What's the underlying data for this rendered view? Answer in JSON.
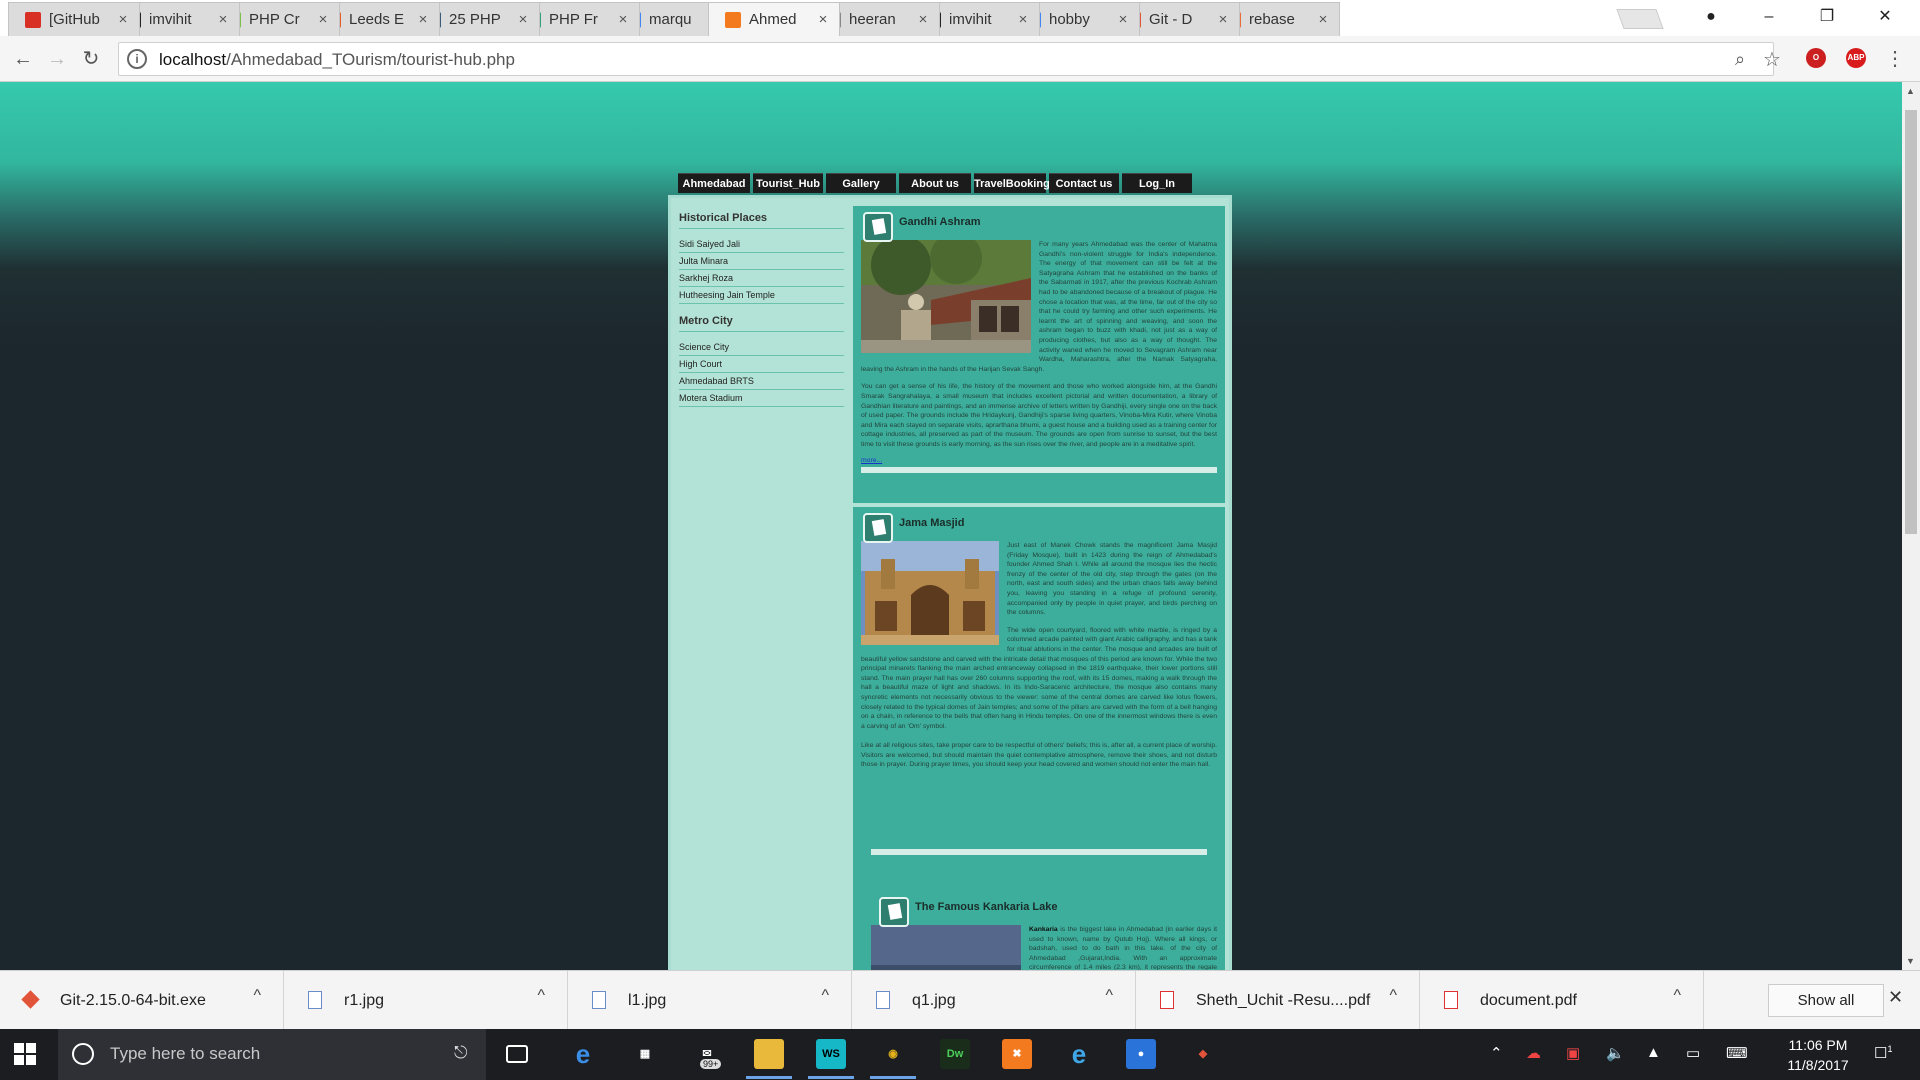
{
  "browser": {
    "tabs": [
      {
        "title": "[GitHub",
        "icon": "gmail-icon",
        "color": "#d93025"
      },
      {
        "title": "imvihit",
        "icon": "github-icon",
        "color": "#222222"
      },
      {
        "title": "PHP Cr",
        "icon": "php-site-icon",
        "color": "#7cc04b"
      },
      {
        "title": "Leeds E",
        "icon": "leeds-icon",
        "color": "#e65a2a"
      },
      {
        "title": "25 PHP",
        "icon": "laptop-icon",
        "color": "#3a5a78"
      },
      {
        "title": "PHP Fr",
        "icon": "php-framework-icon",
        "color": "#35a07a"
      },
      {
        "title": "marqu",
        "icon": "google-icon",
        "color": "#4285f4"
      },
      {
        "title": "Ahmed",
        "icon": "xampp-icon",
        "color": "#f47a20"
      },
      {
        "title": "heeran",
        "icon": "document-icon",
        "color": "#888888"
      },
      {
        "title": "imvihit",
        "icon": "github-icon",
        "color": "#222222"
      },
      {
        "title": "hobby",
        "icon": "google-icon",
        "color": "#4285f4"
      },
      {
        "title": "Git - D",
        "icon": "git-icon",
        "color": "#e2543a"
      },
      {
        "title": "rebase",
        "icon": "rebase-icon",
        "color": "#e86b3a"
      }
    ],
    "active_tab": 7,
    "url_host": "localhost",
    "url_path": "/Ahmedabad_TOurism/tourist-hub.php",
    "win_min": "–",
    "win_max": "❐",
    "win_close": "✕",
    "close_glyph": "×",
    "back_glyph": "←",
    "forward_glyph": "→",
    "reload_glyph": "↻",
    "zoom_glyph": "⌕",
    "star_glyph": "☆",
    "menu_glyph": "⋮",
    "abp_label": "ABP"
  },
  "site": {
    "menu": [
      "Ahmedabad",
      "Tourist_Hub",
      "Gallery",
      "About us",
      "TravelBooking",
      "Contact us",
      "Log_In"
    ],
    "sidebar": {
      "historical_heading": "Historical Places",
      "historical_items": [
        "Sidi Saiyed Jali",
        "Julta Minara",
        "Sarkhej Roza",
        "Hutheesing Jain Temple"
      ],
      "metro_heading": "Metro City",
      "metro_items": [
        "Science City",
        "High Court",
        "Ahmedabad BRTS",
        "Motera Stadium"
      ]
    },
    "posts": {
      "gandhi": {
        "title": "Gandhi Ashram",
        "p1": "For many years Ahmedabad was the center of Mahatma Gandhi's non-violent struggle for India's independence. The energy of that movement can still be felt at the Satyagraha Ashram that he established on the banks of the Sabarmati in 1917, after the previous Kochrab Ashram had to be abandoned because of a breakout of plague. He chose a location that was, at the time, far out of the city so that he could try farming and other such experiments. He learnt the art of spinning and weaving, and soon the ashram began to buzz with khadi, not just as a way of producing clothes, but also as a way of thought. The activity waned when he moved to Sevagram Ashram near Wardha, Maharashtra, after the Namak Satyagraha, leaving the Ashram in the hands of the Harijan Sevak Sangh.",
        "p2": "You can get a sense of his life, the history of the movement and those who worked alongside him, at the Gandhi Smarak Sangrahalaya, a small museum that includes excellent pictorial and written documentation, a library of Gandhian literature and paintings, and an immense archive of letters written by Gandhiji, every single one on the back of used paper. The grounds include the Hridaykunj, Gandhiji's sparse living quarters, Vinoba-Mira Kutir, where Vinoba and Mira each stayed on separate visits, aprarthana bhumi, a guest house and a building used as a training center for cottage industries, all preserved as part of the museum. The grounds are open from sunrise to sunset, but the best time to visit these grounds is early morning, as the sun rises over the river, and people are in a meditative spirit.",
        "more": "more..."
      },
      "jama": {
        "title": "Jama Masjid",
        "p1": "Just east of Manek Chowk stands the magnificent Jama Masjid (Friday Mosque), built in 1423 during the reign of Ahmedabad's founder Ahmed Shah I. While all around the mosque lies the hectic frenzy of the center of the old city, step through the gates (on the north, east and south sides) and the urban chaos falls away behind you, leaving you standing in a refuge of profound serenity, accompanied only by people in quiet prayer, and birds perching on the columns.",
        "p2": "The wide open courtyard, floored with white marble, is ringed by a columned arcade painted with giant Arabic calligraphy, and has a tank for ritual ablutions in the center. The mosque and arcades are built of beautiful yellow sandstone and carved with the intricate detail that mosques of this period are known for. While the two principal minarets flanking the main arched entranceway collapsed in the 1819 earthquake, their lower portions still stand. The main prayer hall has over 260 columns supporting the roof, with its 15 domes, making a walk through the hall a beautiful maze of light and shadows. In its Indo-Saracenic architecture, the mosque also contains many syncretic elements not necessarily obvious to the viewer: some of the central domes are carved like lotus flowers, closely related to the typical domes of Jain temples; and some of the pillars are carved with the form of a bell hanging on a chain, in reference to the bells that often hang in Hindu temples. On one of the innermost windows there is even a carving of an 'Om' symbol.",
        "p3": "Like at all religious sites, take proper care to be respectful of others' beliefs; this is, after all, a current place of worship. Visitors are welcomed, but should maintain the quiet contemplative atmosphere, remove their shoes, and not disturb those in prayer. During prayer times, you should keep your head covered and women should not enter the main hall."
      },
      "kankaria": {
        "title": "The Famous Kankaria Lake",
        "bold": "Kankaria",
        "p1": " is the biggest lake in Ahmedabad (in earlier days it used to known, name by Qutub Hoj). Where all kings, or badshah, used to do bath in this lake. of the city of Ahmedabad ,Gujarat,India. With an approximate circumference of 1.4 miles (2.3 km), it represents the regale history of"
      }
    }
  },
  "downloads": {
    "items": [
      {
        "name": "Git-2.15.0-64-bit.exe",
        "kind": "git"
      },
      {
        "name": "r1.jpg",
        "kind": "img"
      },
      {
        "name": "l1.jpg",
        "kind": "img"
      },
      {
        "name": "q1.jpg",
        "kind": "img"
      },
      {
        "name": "Sheth_Uchit -Resu....pdf",
        "kind": "pdf"
      },
      {
        "name": "document.pdf",
        "kind": "pdf"
      }
    ],
    "chevron": "^",
    "show_all": "Show all",
    "close": "✕"
  },
  "taskbar": {
    "search_placeholder": "Type here to search",
    "mail_badge": "99+",
    "apps": [
      {
        "name": "task-view-icon",
        "label": "",
        "bg": "transparent",
        "fg": "#ffffff",
        "running": false
      },
      {
        "name": "edge-icon",
        "label": "e",
        "bg": "transparent",
        "fg": "#3b8ee6",
        "running": false
      },
      {
        "name": "store-icon",
        "label": "▦",
        "bg": "transparent",
        "fg": "#ffffff",
        "running": false
      },
      {
        "name": "mail-icon",
        "label": "✉",
        "bg": "transparent",
        "fg": "#ffffff",
        "running": false
      },
      {
        "name": "file-explorer-icon",
        "label": "▬",
        "bg": "#e8b93a",
        "fg": "#e8b93a",
        "running": true
      },
      {
        "name": "webstorm-icon",
        "label": "WS",
        "bg": "#16b8c8",
        "fg": "#000000",
        "running": true
      },
      {
        "name": "chrome-icon",
        "label": "◉",
        "bg": "transparent",
        "fg": "#e3b21b",
        "running": true
      },
      {
        "name": "dreamweaver-icon",
        "label": "Dw",
        "bg": "#1a2d1a",
        "fg": "#4bcf5a",
        "running": false
      },
      {
        "name": "xampp-icon",
        "label": "✖",
        "bg": "#f47a20",
        "fg": "#ffffff",
        "running": false
      },
      {
        "name": "internet-explorer-icon",
        "label": "e",
        "bg": "transparent",
        "fg": "#3fa6e8",
        "running": false
      },
      {
        "name": "maps-icon",
        "label": "●",
        "bg": "#2a73d8",
        "fg": "#ffffff",
        "running": false
      },
      {
        "name": "git-gui-icon",
        "label": "◆",
        "bg": "transparent",
        "fg": "#e2543a",
        "running": false
      }
    ],
    "time": "11:06 PM",
    "date": "11/8/2017",
    "notification_badge": "1"
  }
}
